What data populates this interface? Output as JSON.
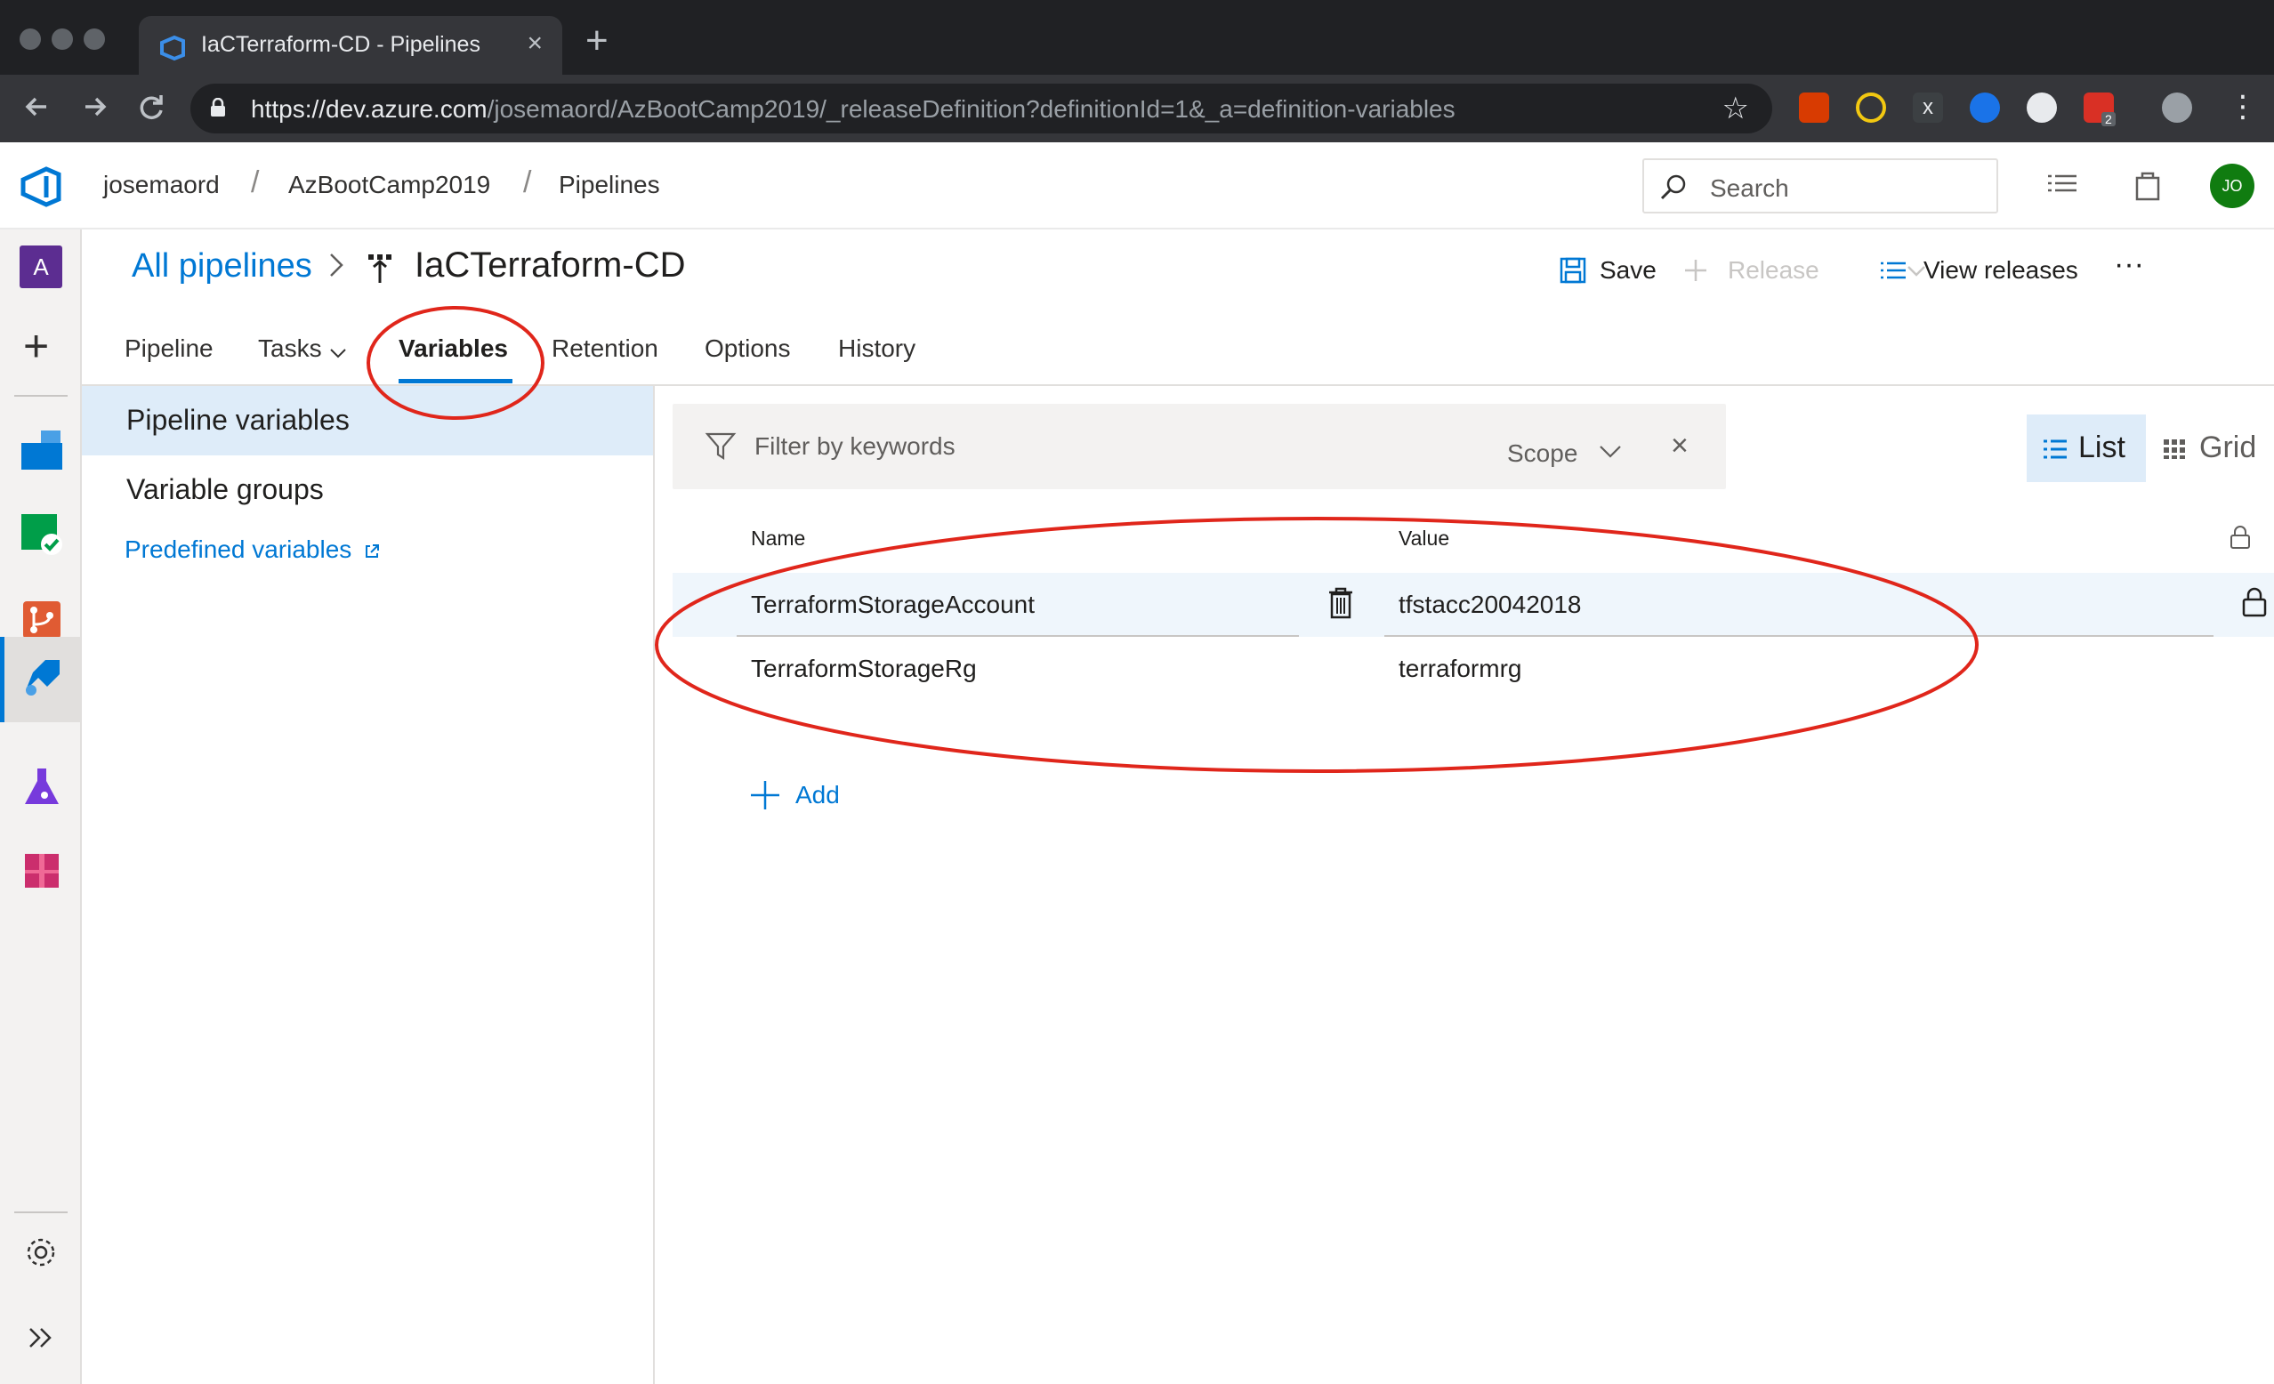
{
  "browser": {
    "tab_title": "IaCTerraform-CD - Pipelines",
    "close_glyph": "×",
    "new_tab_glyph": "+",
    "url_host": "https://dev.azure.com",
    "url_path": "/josemaord/AzBootCamp2019/_releaseDefinition?definitionId=1&_a=definition-variables",
    "extension_badge": "2",
    "colors": {
      "frame": "#202124",
      "toolbar": "#35363a"
    }
  },
  "header": {
    "breadcrumbs": [
      "josemaord",
      "AzBootCamp2019",
      "Pipelines"
    ],
    "search_placeholder": "Search",
    "avatar_initials": "JO",
    "colors": {
      "accent": "#0078d4",
      "avatar": "#107c10"
    }
  },
  "rail": {
    "org_initial": "A",
    "items": [
      "overview-icon",
      "boards-icon",
      "repos-icon",
      "pipelines-icon",
      "test-plans-icon",
      "artifacts-icon"
    ]
  },
  "title": {
    "all_pipelines": "All pipelines",
    "pipeline_name": "IaCTerraform-CD",
    "save": "Save",
    "release": "Release",
    "view_releases": "View releases",
    "more": "···"
  },
  "tabs": [
    "Pipeline",
    "Tasks",
    "Variables",
    "Retention",
    "Options",
    "History"
  ],
  "left_panel": {
    "items": [
      "Pipeline variables",
      "Variable groups"
    ],
    "link": "Predefined variables"
  },
  "filter": {
    "placeholder": "Filter by keywords",
    "scope": "Scope",
    "clear": "×"
  },
  "view": {
    "list": "List",
    "grid": "Grid"
  },
  "table": {
    "columns": {
      "name": "Name",
      "value": "Value"
    },
    "rows": [
      {
        "name": "TerraformStorageAccount",
        "value": "tfstacc20042018"
      },
      {
        "name": "TerraformStorageRg",
        "value": "terraformrg"
      }
    ],
    "add_label": "Add"
  },
  "annotation_color": "#e0261b"
}
